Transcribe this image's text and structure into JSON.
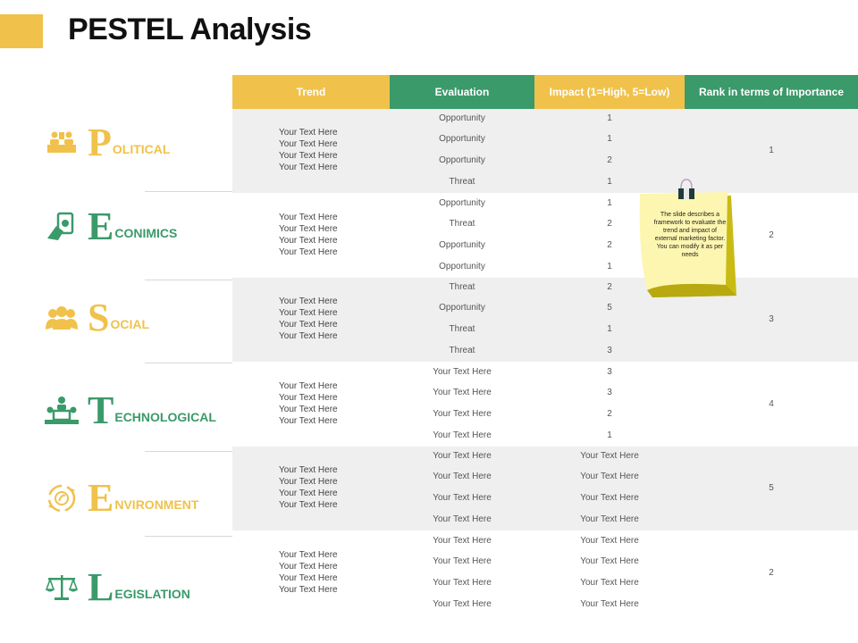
{
  "title": "PESTEL Analysis",
  "colors": {
    "yellow": "#f0c24b",
    "green": "#3a9a6a",
    "band": "#efefef"
  },
  "headers": {
    "trend": "Trend",
    "evaluation": "Evaluation",
    "impact": "Impact (1=High, 5=Low)",
    "rank": "Rank in terms of Importance"
  },
  "rows": [
    {
      "letter": "P",
      "rest": "OLITICAL",
      "icon": "meeting-icon",
      "color": "yellow",
      "trend": [
        "Your Text Here",
        "Your Text Here",
        "Your Text Here",
        "Your Text Here"
      ],
      "evaluation": [
        "Opportunity",
        "Opportunity",
        "Opportunity",
        "Threat"
      ],
      "impact": [
        "1",
        "1",
        "2",
        "1"
      ],
      "rank": "1"
    },
    {
      "letter": "E",
      "rest": "CONIMICS",
      "icon": "money-hand-icon",
      "color": "green",
      "trend": [
        "Your Text Here",
        "Your Text Here",
        "Your Text Here",
        "Your Text Here"
      ],
      "evaluation": [
        "Opportunity",
        "Threat",
        "Opportunity",
        "Opportunity"
      ],
      "impact": [
        "1",
        "2",
        "2",
        "1"
      ],
      "rank": "2"
    },
    {
      "letter": "S",
      "rest": "OCIAL",
      "icon": "people-group-icon",
      "color": "yellow",
      "trend": [
        "Your Text Here",
        "Your Text Here",
        "Your Text Here",
        "Your Text Here"
      ],
      "evaluation": [
        "Threat",
        "Opportunity",
        "Threat",
        "Threat"
      ],
      "impact": [
        "2",
        "5",
        "1",
        "3"
      ],
      "rank": "3"
    },
    {
      "letter": "T",
      "rest": "ECHNOLOGICAL",
      "icon": "team-computer-icon",
      "color": "green",
      "trend": [
        "Your Text Here",
        "Your Text Here",
        "Your Text Here",
        "Your Text Here"
      ],
      "evaluation": [
        "Your Text Here",
        "Your Text Here",
        "Your Text Here",
        "Your Text Here"
      ],
      "impact": [
        "3",
        "3",
        "2",
        "1"
      ],
      "rank": "4"
    },
    {
      "letter": "E",
      "rest": "NVIRONMENT",
      "icon": "eco-cycle-icon",
      "color": "yellow",
      "trend": [
        "Your Text Here",
        "Your Text Here",
        "Your Text Here",
        "Your Text Here"
      ],
      "evaluation": [
        "Your Text Here",
        "Your Text Here",
        "Your Text Here",
        "Your Text Here"
      ],
      "impact": [
        "Your Text Here",
        "Your Text Here",
        "Your Text Here",
        "Your Text Here"
      ],
      "rank": "5"
    },
    {
      "letter": "L",
      "rest": "EGISLATION",
      "icon": "scales-icon",
      "color": "green",
      "trend": [
        "Your Text Here",
        "Your Text Here",
        "Your Text Here",
        "Your Text Here"
      ],
      "evaluation": [
        "Your Text Here",
        "Your Text Here",
        "Your Text Here",
        "Your Text Here"
      ],
      "impact": [
        "Your Text Here",
        "Your Text Here",
        "Your Text Here",
        "Your Text Here"
      ],
      "rank": "2"
    }
  ],
  "note": "The slide describes a framework to evaluate the trend and impact of external marketing factor. You can modify it as per needs",
  "note_icon": "binder-clip-icon"
}
